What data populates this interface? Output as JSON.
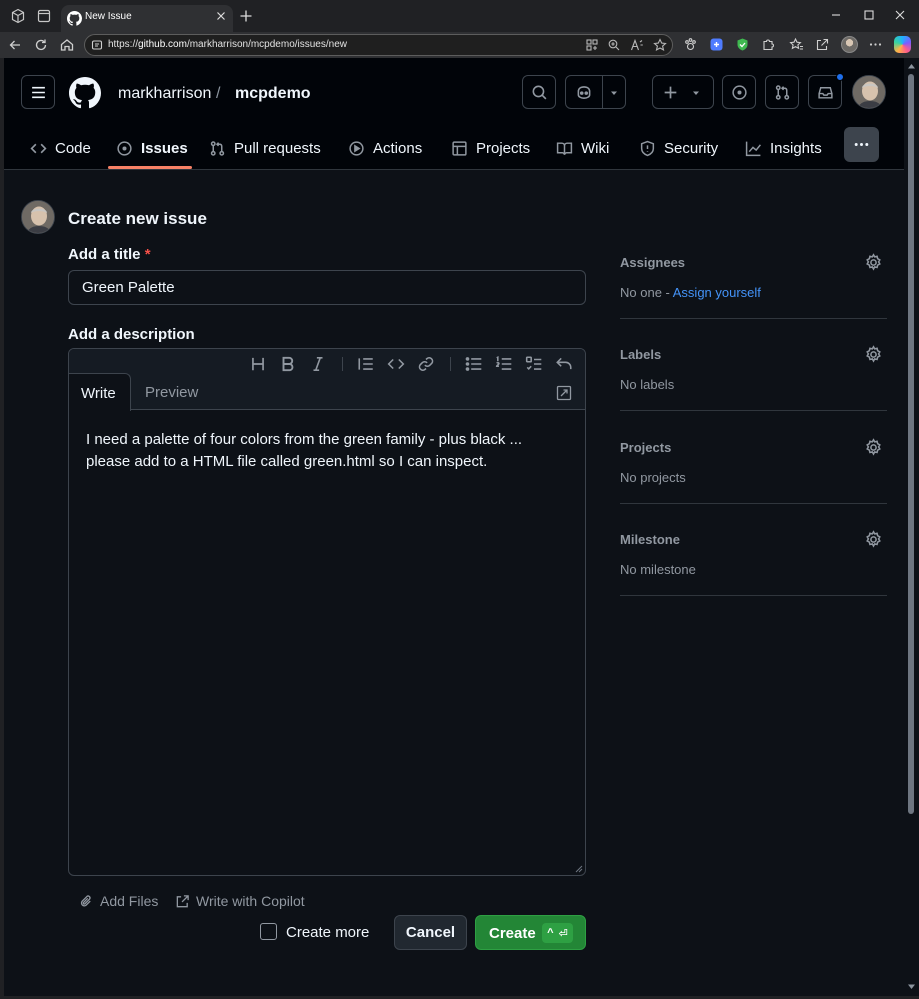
{
  "browser": {
    "tab_title": "New Issue",
    "url_prefix": "https://",
    "url_host": "github.com",
    "url_path": "/markharrison/mcpdemo/issues/new"
  },
  "repo": {
    "owner": "markharrison",
    "separator": "/",
    "name": "mcpdemo"
  },
  "nav": {
    "tabs": [
      {
        "label": "Code",
        "icon": "code-icon"
      },
      {
        "label": "Issues",
        "icon": "issue-opened-icon",
        "active": true
      },
      {
        "label": "Pull requests",
        "icon": "pull-request-icon"
      },
      {
        "label": "Actions",
        "icon": "play-icon"
      },
      {
        "label": "Projects",
        "icon": "table-icon"
      },
      {
        "label": "Wiki",
        "icon": "book-icon"
      },
      {
        "label": "Security",
        "icon": "shield-icon"
      },
      {
        "label": "Insights",
        "icon": "graph-icon"
      }
    ]
  },
  "form": {
    "heading": "Create new issue",
    "title_label": "Add a title",
    "required_mark": "*",
    "title_value": "Green Palette",
    "description_label": "Add a description",
    "tab_write": "Write",
    "tab_preview": "Preview",
    "description_line1": "I need a palette of four colors from the green family - plus black ...",
    "description_line2": "please add to a HTML file called green.html so I can inspect.",
    "add_files": "Add Files",
    "write_with_copilot": "Write with Copilot",
    "create_more": "Create more",
    "create_more_checked": false,
    "cancel": "Cancel",
    "create": "Create",
    "create_shortcut_ctrl": "^",
    "create_shortcut_enter": "⏎"
  },
  "sidebar": {
    "assignees": {
      "heading": "Assignees",
      "value": "No one - ",
      "link": "Assign yourself"
    },
    "labels": {
      "heading": "Labels",
      "value": "No labels"
    },
    "projects": {
      "heading": "Projects",
      "value": "No projects"
    },
    "milestone": {
      "heading": "Milestone",
      "value": "No milestone"
    }
  },
  "colors": {
    "page_bg": "#0d1117",
    "header_bg": "#010409",
    "accent_underline": "#f78166",
    "primary_button": "#238636",
    "link": "#4493f8",
    "notification_dot": "#1f6feb"
  }
}
